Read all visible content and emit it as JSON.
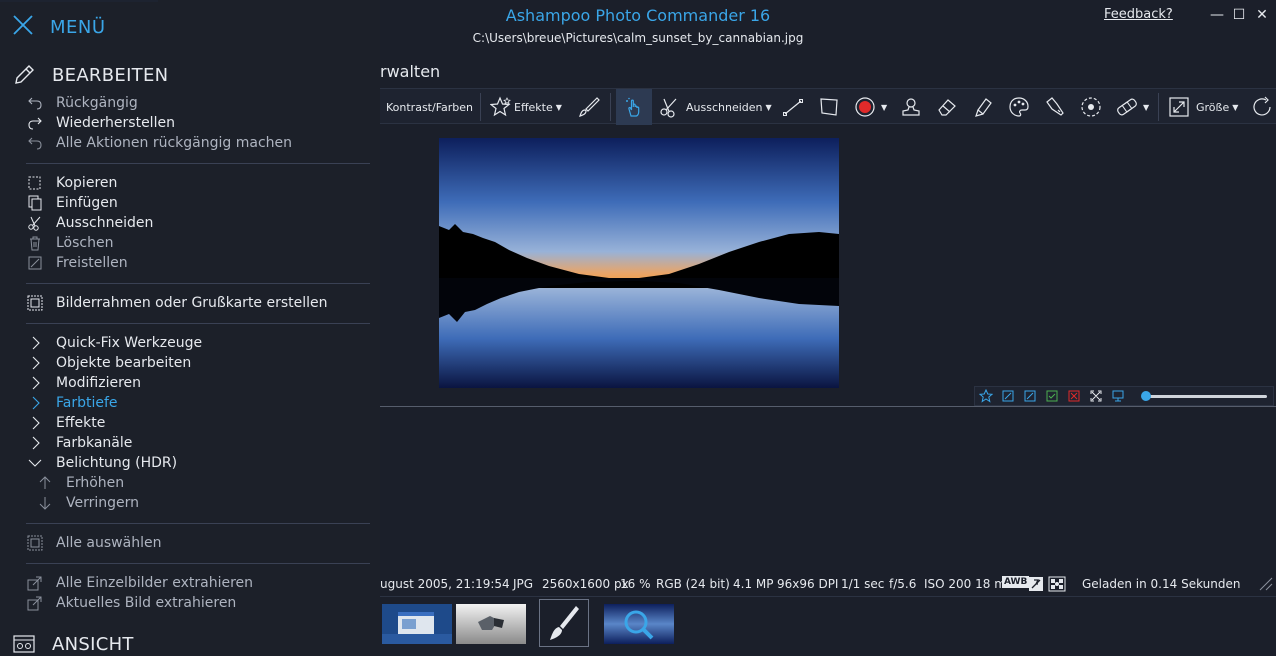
{
  "window": {
    "app_title": "Ashampoo Photo Commander 16",
    "file_path": "C:\\Users\\breue\\Pictures\\calm_sunset_by_cannabian.jpg",
    "feedback_label": "Feedback?",
    "minimize_glyph": "—",
    "maximize_glyph": "☐",
    "close_glyph": "✕"
  },
  "ribbon": {
    "section_label": "rwalten"
  },
  "toolbar": {
    "contrast_label": "Kontrast/Farben",
    "effects_label": "Effekte",
    "cut_label": "Ausschneiden",
    "size_label": "Größe"
  },
  "menu": {
    "title": "MENÜ",
    "sections": {
      "edit": "BEARBEITEN",
      "view": "ANSICHT"
    },
    "items": {
      "undo": "Rückgängig",
      "redo": "Wiederherstellen",
      "undo_all": "Alle Aktionen rückgängig machen",
      "copy": "Kopieren",
      "paste": "Einfügen",
      "cut": "Ausschneiden",
      "delete": "Löschen",
      "crop": "Freistellen",
      "frame": "Bilderrahmen oder Grußkarte erstellen",
      "quickfix": "Quick-Fix Werkzeuge",
      "edit_objects": "Objekte bearbeiten",
      "modify": "Modifizieren",
      "color_depth": "Farbtiefe",
      "effects": "Effekte",
      "color_channels": "Farbkanäle",
      "exposure": "Belichtung (HDR)",
      "increase": "Erhöhen",
      "decrease": "Verringern",
      "select_all": "Alle auswählen",
      "extract_all": "Alle Einzelbilder extrahieren",
      "extract_current": "Aktuelles Bild extrahieren"
    }
  },
  "status": {
    "date": "ugust 2005, 21:19:54",
    "format": "JPG",
    "dimensions": "2560x1600 px",
    "zoom": "16 %",
    "color": "RGB (24 bit)",
    "megapixels": "4.1 MP",
    "dpi": "96x96 DPI",
    "shutter": "1/1 sec",
    "aperture": "f/5.6",
    "iso_focal": "ISO 200 18 mm",
    "awb": "AWB",
    "loaded": "Geladen in 0.14 Sekunden"
  },
  "colors": {
    "accent": "#3aa6e8",
    "background": "#1b1f2a",
    "record_red": "#e02a2a"
  }
}
